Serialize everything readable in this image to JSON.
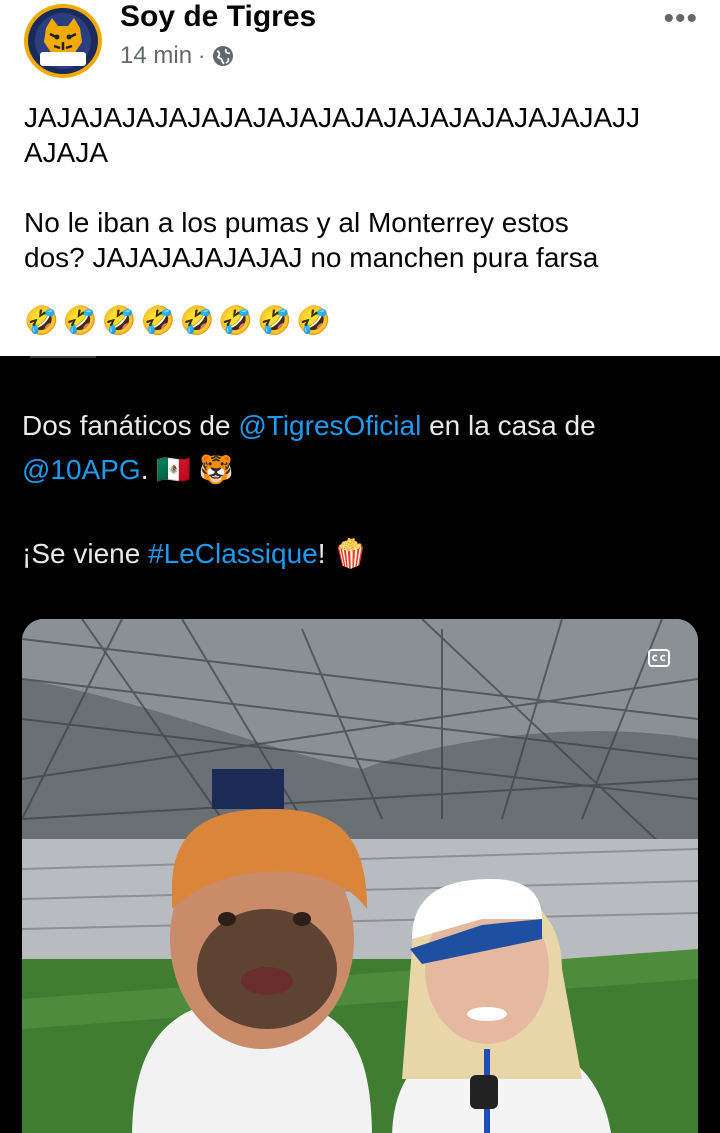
{
  "post": {
    "page_name": "Soy de Tigres",
    "time": "14 min",
    "separator": "·",
    "privacy_icon": "globe-icon",
    "more_icon": "more-options-icon",
    "more_label": "•••",
    "text": "JAJAJAJAJAJAJAJAJAJAJAJAJAJAJAJAJAJAJJ\nAJAJA\n\nNo le iban a los pumas y al Monterrey estos\ndos? JAJAJAJAJAJAJ no manchen pura farsa",
    "emojis": [
      "🤣",
      "🤣",
      "🤣",
      "🤣",
      "🤣",
      "🤣",
      "🤣",
      "🤣"
    ],
    "avatar_text": "SOY DE TIGRES"
  },
  "tweet": {
    "line1_pre": "Dos fanáticos de ",
    "mention1": "@TigresOficial",
    "line1_post": " en la casa de",
    "mention2": "@10APG",
    "line2_post": ". 🇲🇽 🐯",
    "line3_pre": "¡Se viene ",
    "hashtag": "#LeClassique",
    "line3_post": "! 🍿"
  },
  "colors": {
    "link": "#1d9bf0",
    "meta_gray": "#65676b",
    "accent_gold": "#f2a900"
  }
}
